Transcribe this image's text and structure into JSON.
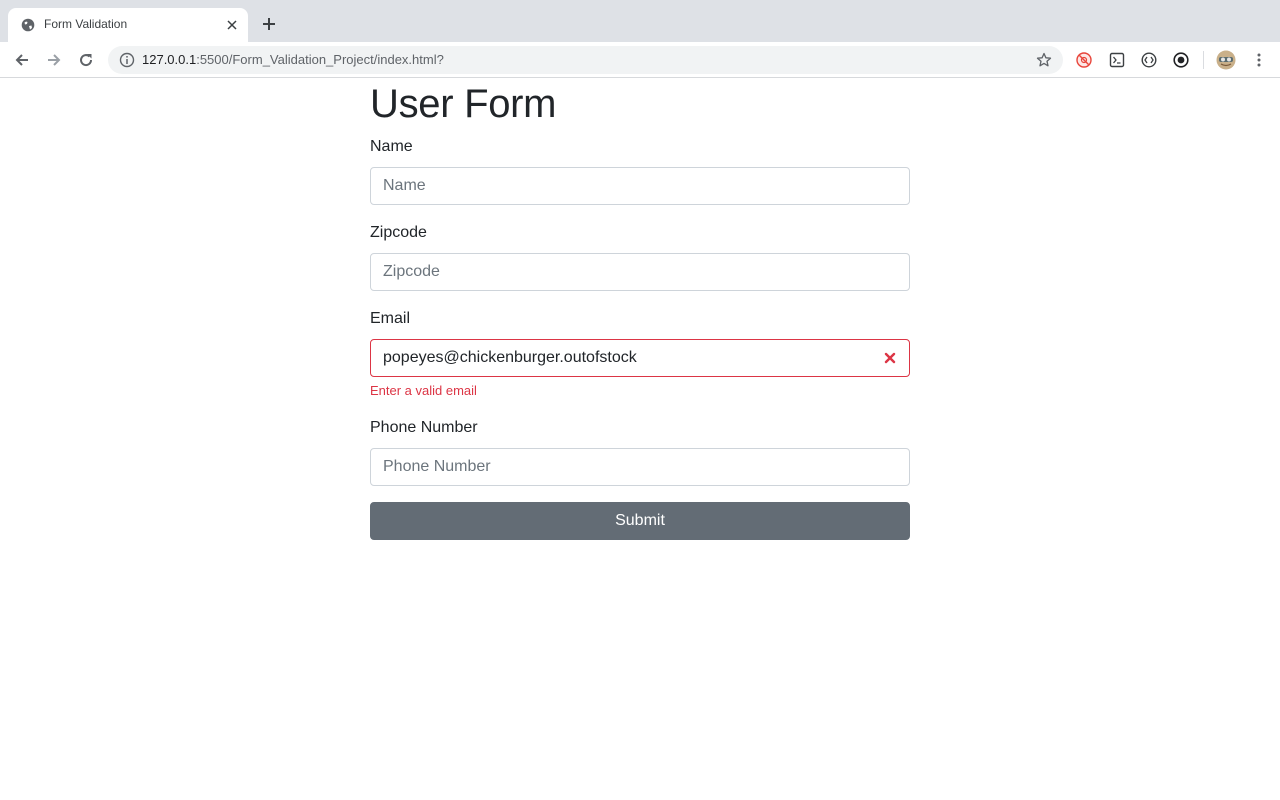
{
  "browser": {
    "tab_title": "Form Validation",
    "url_host": "127.0.0.1",
    "url_rest": ":5500/Form_Validation_Project/index.html?",
    "icons": [
      "globe-icon",
      "close-icon",
      "plus-icon",
      "back-icon",
      "forward-icon",
      "reload-icon",
      "info-icon",
      "star-icon",
      "extension-icon",
      "profile-avatar-icon",
      "menu-dots-icon"
    ]
  },
  "form": {
    "title": "User Form",
    "name": {
      "label": "Name",
      "placeholder": "Name",
      "value": ""
    },
    "zipcode": {
      "label": "Zipcode",
      "placeholder": "Zipcode",
      "value": ""
    },
    "email": {
      "label": "Email",
      "value": "popeyes@chickenburger.outofstock",
      "error": "Enter a valid email"
    },
    "phone": {
      "label": "Phone Number",
      "placeholder": "Phone Number",
      "value": ""
    },
    "submit_label": "Submit"
  },
  "colors": {
    "error": "#dc3545",
    "submit_bg": "#636c75",
    "text": "#212529"
  }
}
